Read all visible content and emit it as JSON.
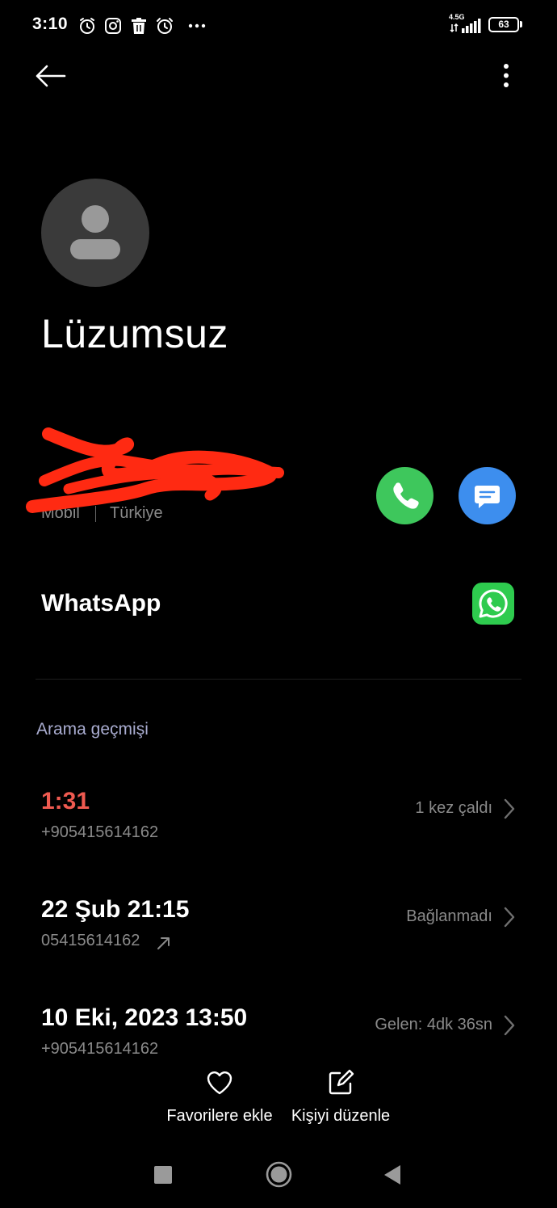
{
  "status_bar": {
    "time": "3:10",
    "network": "4.5G",
    "battery": "63",
    "battery_level": 0.63,
    "icons": [
      "alarm-icon",
      "instagram-icon",
      "trash-icon",
      "alarm-clock-icon",
      "more-dots-icon",
      "signal-icon",
      "battery-icon"
    ]
  },
  "header": {
    "back_icon": "arrow-left-icon",
    "menu_icon": "more-vertical-icon"
  },
  "contact": {
    "name": "Lüzumsuz",
    "number_type": "Mobil",
    "number_country": "Türkiye",
    "avatar_icon": "person-icon"
  },
  "actions": {
    "call_icon": "phone-icon",
    "message_icon": "message-icon",
    "call_color": "#3ec75c",
    "message_color": "#3d8eee"
  },
  "whatsapp": {
    "label": "WhatsApp",
    "icon": "whatsapp-icon",
    "color": "#2ecb4e"
  },
  "history": {
    "title": "Arama geçmişi",
    "calls": [
      {
        "time": "1:31",
        "number": "+905415614162",
        "status": "1 kez çaldı",
        "type": "missed"
      },
      {
        "time": "22 Şub 21:15",
        "number": "05415614162",
        "status": "Bağlanmadı",
        "type": "outgoing"
      },
      {
        "time": "10 Eki, 2023 13:50",
        "number": "+905415614162",
        "status": "Gelen: 4dk 36sn",
        "type": "incoming"
      }
    ]
  },
  "bottom_actions": {
    "favorite_label": "Favorilere ekle",
    "edit_label": "Kişiyi düzenle",
    "favorite_icon": "heart-icon",
    "edit_icon": "edit-icon"
  },
  "nav": {
    "icons": [
      "recents-icon",
      "home-icon",
      "back-triangle-icon"
    ]
  },
  "colors": {
    "missed": "#ef5a50",
    "secondary_text": "#8a8a8a",
    "section_title": "#a9acd0"
  }
}
